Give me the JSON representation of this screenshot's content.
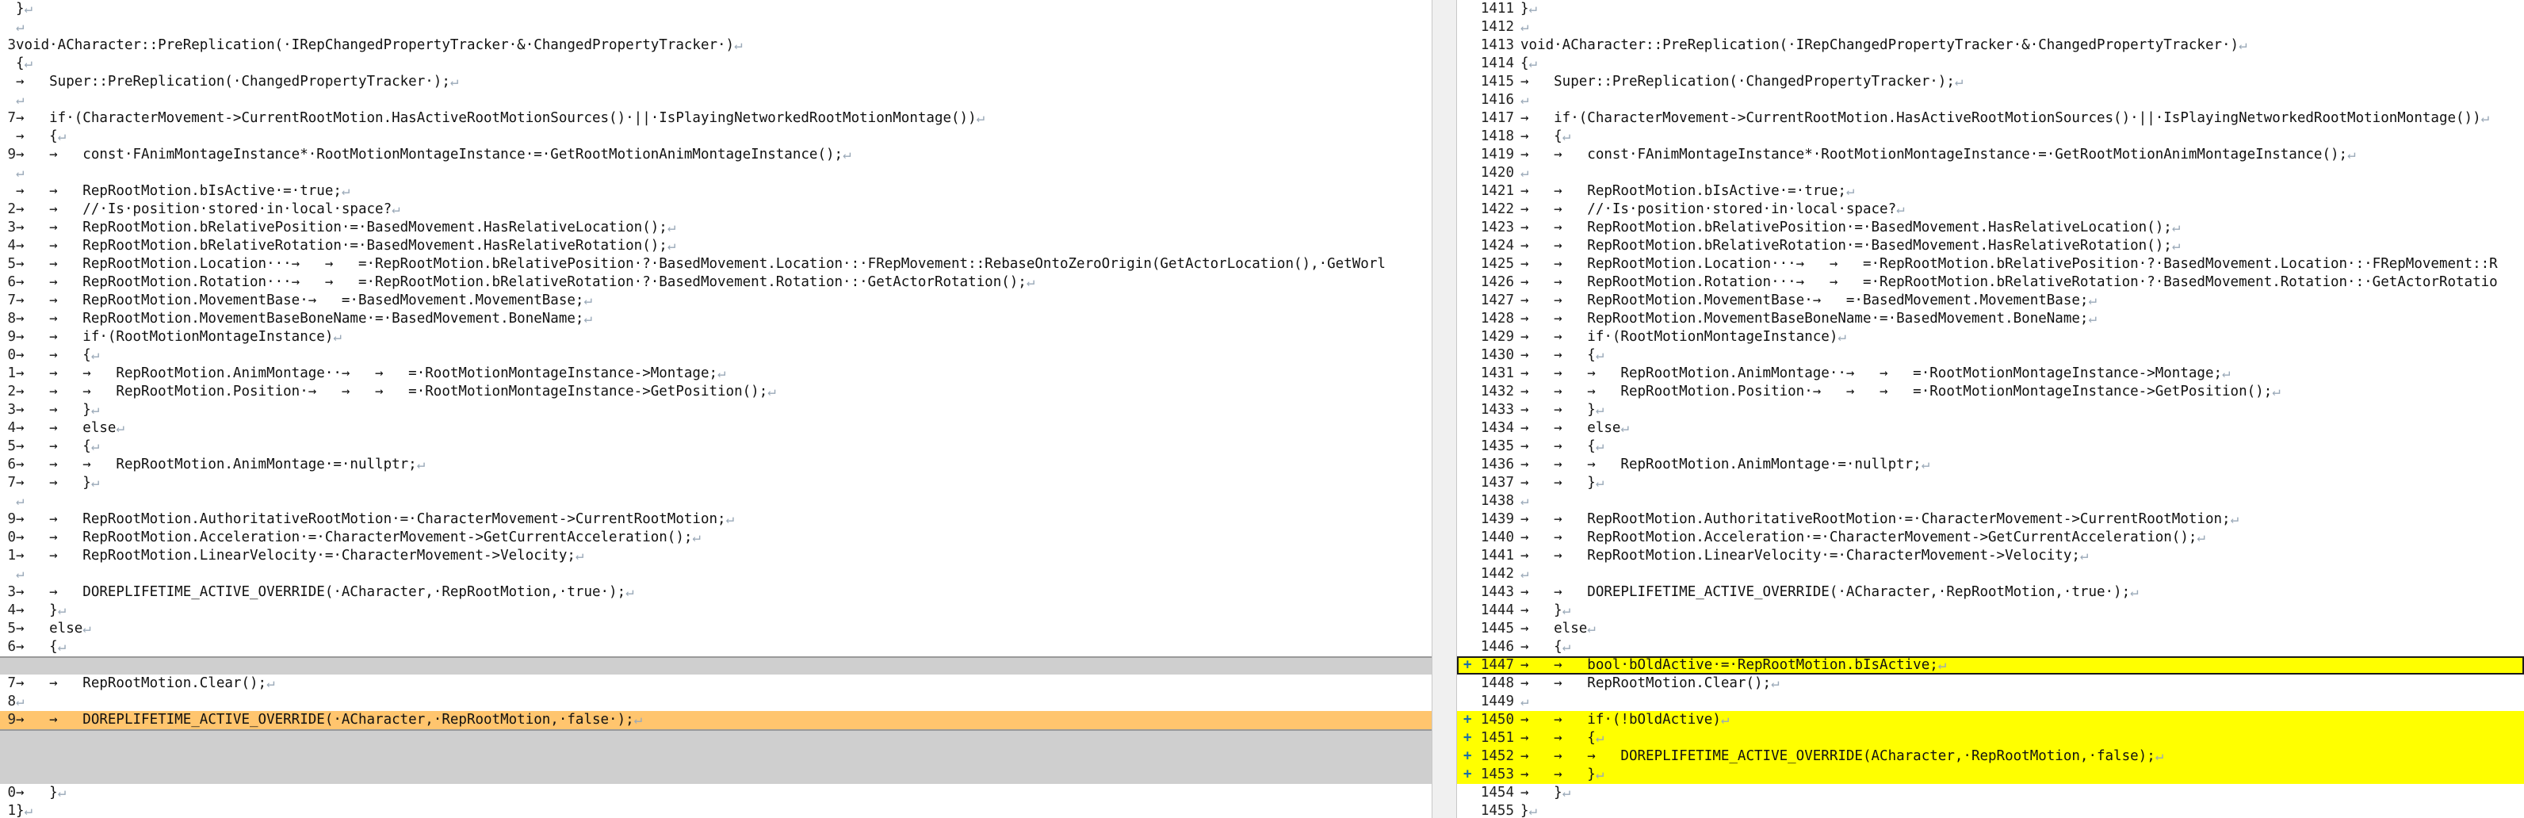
{
  "left": {
    "lines": [
      {
        "num": "",
        "text": "}",
        "lf": "↵"
      },
      {
        "num": "",
        "text": "",
        "lf": "↵"
      },
      {
        "num": "3",
        "text": "void·ACharacter::PreReplication(·IRepChangedPropertyTracker·&·ChangedPropertyTracker·)",
        "lf": "↵"
      },
      {
        "num": "",
        "text": "{",
        "lf": "↵"
      },
      {
        "num": "",
        "text": "→   Super::PreReplication(·ChangedPropertyTracker·);",
        "lf": "↵"
      },
      {
        "num": "",
        "text": "",
        "lf": "↵"
      },
      {
        "num": "7",
        "text": "→   if·(CharacterMovement->CurrentRootMotion.HasActiveRootMotionSources()·||·IsPlayingNetworkedRootMotionMontage())",
        "lf": "↵"
      },
      {
        "num": "",
        "text": "→   {",
        "lf": "↵"
      },
      {
        "num": "9",
        "text": "→   →   const·FAnimMontageInstance*·RootMotionMontageInstance·=·GetRootMotionAnimMontageInstance();",
        "lf": "↵"
      },
      {
        "num": "",
        "text": "",
        "lf": "↵"
      },
      {
        "num": "",
        "text": "→   →   RepRootMotion.bIsActive·=·true;",
        "lf": "↵"
      },
      {
        "num": "2",
        "text": "→   →   //·Is·position·stored·in·local·space?",
        "lf": "↵"
      },
      {
        "num": "3",
        "text": "→   →   RepRootMotion.bRelativePosition·=·BasedMovement.HasRelativeLocation();",
        "lf": "↵"
      },
      {
        "num": "4",
        "text": "→   →   RepRootMotion.bRelativeRotation·=·BasedMovement.HasRelativeRotation();",
        "lf": "↵"
      },
      {
        "num": "5",
        "text": "→   →   RepRootMotion.Location···→   →   =·RepRootMotion.bRelativePosition·?·BasedMovement.Location·:·FRepMovement::RebaseOntoZeroOrigin(GetActorLocation(),·GetWorl",
        "lf": ""
      },
      {
        "num": "6",
        "text": "→   →   RepRootMotion.Rotation···→   →   =·RepRootMotion.bRelativeRotation·?·BasedMovement.Rotation·:·GetActorRotation();",
        "lf": "↵"
      },
      {
        "num": "7",
        "text": "→   →   RepRootMotion.MovementBase·→   =·BasedMovement.MovementBase;",
        "lf": "↵"
      },
      {
        "num": "8",
        "text": "→   →   RepRootMotion.MovementBaseBoneName·=·BasedMovement.BoneName;",
        "lf": "↵"
      },
      {
        "num": "9",
        "text": "→   →   if·(RootMotionMontageInstance)",
        "lf": "↵"
      },
      {
        "num": "0",
        "text": "→   →   {",
        "lf": "↵"
      },
      {
        "num": "1",
        "text": "→   →   →   RepRootMotion.AnimMontage··→   →   =·RootMotionMontageInstance->Montage;",
        "lf": "↵"
      },
      {
        "num": "2",
        "text": "→   →   →   RepRootMotion.Position·→   →   →   =·RootMotionMontageInstance->GetPosition();",
        "lf": "↵"
      },
      {
        "num": "3",
        "text": "→   →   }",
        "lf": "↵"
      },
      {
        "num": "4",
        "text": "→   →   else",
        "lf": "↵"
      },
      {
        "num": "5",
        "text": "→   →   {",
        "lf": "↵"
      },
      {
        "num": "6",
        "text": "→   →   →   RepRootMotion.AnimMontage·=·nullptr;",
        "lf": "↵"
      },
      {
        "num": "7",
        "text": "→   →   }",
        "lf": "↵"
      },
      {
        "num": "",
        "text": "",
        "lf": "↵"
      },
      {
        "num": "9",
        "text": "→   →   RepRootMotion.AuthoritativeRootMotion·=·CharacterMovement->CurrentRootMotion;",
        "lf": "↵"
      },
      {
        "num": "0",
        "text": "→   →   RepRootMotion.Acceleration·=·CharacterMovement->GetCurrentAcceleration();",
        "lf": "↵"
      },
      {
        "num": "1",
        "text": "→   →   RepRootMotion.LinearVelocity·=·CharacterMovement->Velocity;",
        "lf": "↵"
      },
      {
        "num": "",
        "text": "",
        "lf": "↵"
      },
      {
        "num": "3",
        "text": "→   →   DOREPLIFETIME_ACTIVE_OVERRIDE(·ACharacter,·RepRootMotion,·true·);",
        "lf": "↵"
      },
      {
        "num": "4",
        "text": "→   }",
        "lf": "↵"
      },
      {
        "num": "5",
        "text": "→   else",
        "lf": "↵"
      },
      {
        "num": "6",
        "text": "→   {",
        "lf": "↵"
      },
      {
        "num": "",
        "text": "",
        "lf": "",
        "style": "gap"
      },
      {
        "num": "7",
        "text": "→   →   RepRootMotion.Clear();",
        "lf": "↵"
      },
      {
        "num": "8",
        "text": "",
        "lf": "↵"
      },
      {
        "num": "9",
        "text": "→   →   DOREPLIFETIME_ACTIVE_OVERRIDE(·ACharacter,·RepRootMotion,·false·);",
        "lf": "↵",
        "style": "changed"
      },
      {
        "num": "",
        "text": "",
        "lf": "",
        "style": "gap"
      },
      {
        "num": "",
        "text": "",
        "lf": "",
        "style": "gap"
      },
      {
        "num": "",
        "text": "",
        "lf": "",
        "style": "gap"
      },
      {
        "num": "0",
        "text": "→   }",
        "lf": "↵"
      },
      {
        "num": "1",
        "text": "}",
        "lf": "↵"
      }
    ]
  },
  "right": {
    "lines": [
      {
        "num": "1411",
        "text": "}",
        "lf": "↵"
      },
      {
        "num": "1412",
        "text": "",
        "lf": "↵"
      },
      {
        "num": "1413",
        "text": "void·ACharacter::PreReplication(·IRepChangedPropertyTracker·&·ChangedPropertyTracker·)",
        "lf": "↵"
      },
      {
        "num": "1414",
        "text": "{",
        "lf": "↵"
      },
      {
        "num": "1415",
        "text": "→   Super::PreReplication(·ChangedPropertyTracker·);",
        "lf": "↵"
      },
      {
        "num": "1416",
        "text": "",
        "lf": "↵"
      },
      {
        "num": "1417",
        "text": "→   if·(CharacterMovement->CurrentRootMotion.HasActiveRootMotionSources()·||·IsPlayingNetworkedRootMotionMontage())",
        "lf": "↵"
      },
      {
        "num": "1418",
        "text": "→   {",
        "lf": "↵"
      },
      {
        "num": "1419",
        "text": "→   →   const·FAnimMontageInstance*·RootMotionMontageInstance·=·GetRootMotionAnimMontageInstance();",
        "lf": "↵"
      },
      {
        "num": "1420",
        "text": "",
        "lf": "↵"
      },
      {
        "num": "1421",
        "text": "→   →   RepRootMotion.bIsActive·=·true;",
        "lf": "↵"
      },
      {
        "num": "1422",
        "text": "→   →   //·Is·position·stored·in·local·space?",
        "lf": "↵"
      },
      {
        "num": "1423",
        "text": "→   →   RepRootMotion.bRelativePosition·=·BasedMovement.HasRelativeLocation();",
        "lf": "↵"
      },
      {
        "num": "1424",
        "text": "→   →   RepRootMotion.bRelativeRotation·=·BasedMovement.HasRelativeRotation();",
        "lf": "↵"
      },
      {
        "num": "1425",
        "text": "→   →   RepRootMotion.Location···→   →   =·RepRootMotion.bRelativePosition·?·BasedMovement.Location·:·FRepMovement::R",
        "lf": ""
      },
      {
        "num": "1426",
        "text": "→   →   RepRootMotion.Rotation···→   →   =·RepRootMotion.bRelativeRotation·?·BasedMovement.Rotation·:·GetActorRotatio",
        "lf": ""
      },
      {
        "num": "1427",
        "text": "→   →   RepRootMotion.MovementBase·→   =·BasedMovement.MovementBase;",
        "lf": "↵"
      },
      {
        "num": "1428",
        "text": "→   →   RepRootMotion.MovementBaseBoneName·=·BasedMovement.BoneName;",
        "lf": "↵"
      },
      {
        "num": "1429",
        "text": "→   →   if·(RootMotionMontageInstance)",
        "lf": "↵"
      },
      {
        "num": "1430",
        "text": "→   →   {",
        "lf": "↵"
      },
      {
        "num": "1431",
        "text": "→   →   →   RepRootMotion.AnimMontage··→   →   =·RootMotionMontageInstance->Montage;",
        "lf": "↵"
      },
      {
        "num": "1432",
        "text": "→   →   →   RepRootMotion.Position·→   →   →   =·RootMotionMontageInstance->GetPosition();",
        "lf": "↵"
      },
      {
        "num": "1433",
        "text": "→   →   }",
        "lf": "↵"
      },
      {
        "num": "1434",
        "text": "→   →   else",
        "lf": "↵"
      },
      {
        "num": "1435",
        "text": "→   →   {",
        "lf": "↵"
      },
      {
        "num": "1436",
        "text": "→   →   →   RepRootMotion.AnimMontage·=·nullptr;",
        "lf": "↵"
      },
      {
        "num": "1437",
        "text": "→   →   }",
        "lf": "↵"
      },
      {
        "num": "1438",
        "text": "",
        "lf": "↵"
      },
      {
        "num": "1439",
        "text": "→   →   RepRootMotion.AuthoritativeRootMotion·=·CharacterMovement->CurrentRootMotion;",
        "lf": "↵"
      },
      {
        "num": "1440",
        "text": "→   →   RepRootMotion.Acceleration·=·CharacterMovement->GetCurrentAcceleration();",
        "lf": "↵"
      },
      {
        "num": "1441",
        "text": "→   →   RepRootMotion.LinearVelocity·=·CharacterMovement->Velocity;",
        "lf": "↵"
      },
      {
        "num": "1442",
        "text": "",
        "lf": "↵"
      },
      {
        "num": "1443",
        "text": "→   →   DOREPLIFETIME_ACTIVE_OVERRIDE(·ACharacter,·RepRootMotion,·true·);",
        "lf": "↵"
      },
      {
        "num": "1444",
        "text": "→   }",
        "lf": "↵"
      },
      {
        "num": "1445",
        "text": "→   else",
        "lf": "↵"
      },
      {
        "num": "1446",
        "text": "→   {",
        "lf": "↵"
      },
      {
        "num": "1447",
        "text": "→   →   bool·bOldActive·=·RepRootMotion.bIsActive;",
        "lf": "↵",
        "marker": "+",
        "style": "added-current"
      },
      {
        "num": "1448",
        "text": "→   →   RepRootMotion.Clear();",
        "lf": "↵"
      },
      {
        "num": "1449",
        "text": "",
        "lf": "↵"
      },
      {
        "num": "1450",
        "text": "→   →   if·(!bOldActive)",
        "lf": "↵",
        "marker": "+",
        "style": "added"
      },
      {
        "num": "1451",
        "text": "→   →   {",
        "lf": "↵",
        "marker": "+",
        "style": "added"
      },
      {
        "num": "1452",
        "text": "→   →   →   DOREPLIFETIME_ACTIVE_OVERRIDE(ACharacter,·RepRootMotion,·false);",
        "lf": "↵",
        "marker": "+",
        "style": "added"
      },
      {
        "num": "1453",
        "text": "→   →   }",
        "lf": "↵",
        "marker": "+",
        "style": "added"
      },
      {
        "num": "1454",
        "text": "→   }",
        "lf": "↵"
      },
      {
        "num": "1455",
        "text": "}",
        "lf": "↵"
      }
    ]
  }
}
